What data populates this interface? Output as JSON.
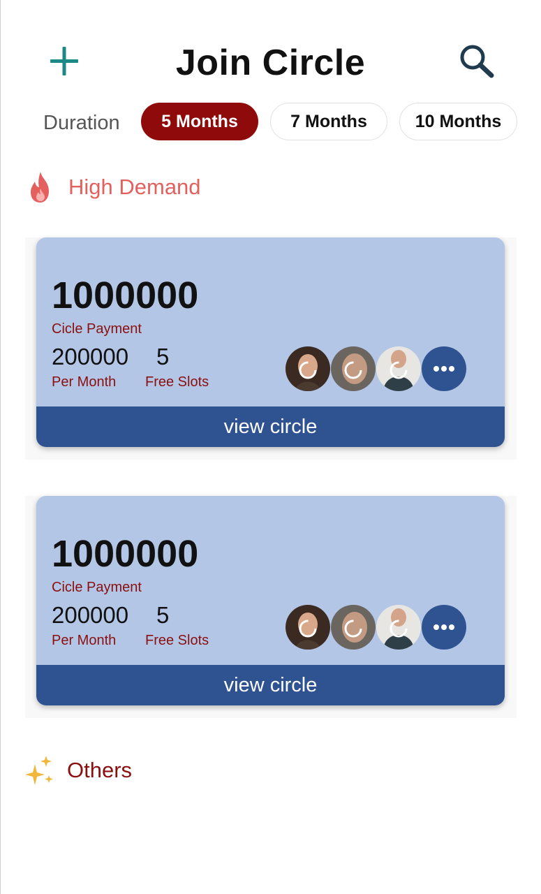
{
  "header": {
    "title": "Join Circle",
    "add_icon": "plus-icon",
    "search_icon": "search-icon"
  },
  "duration": {
    "label": "Duration",
    "options": [
      "5 Months",
      "7 Months",
      "10 Months"
    ],
    "selected": "5 Months"
  },
  "sections": {
    "high_demand": {
      "label": "High Demand",
      "icon": "fire-icon",
      "color": "#e4605e"
    },
    "others": {
      "label": "Others",
      "icon": "sparkles-icon",
      "color": "#8a1010"
    }
  },
  "circles": [
    {
      "amount": "1000000",
      "amount_label": "Cicle Payment",
      "per_month_value": "200000",
      "per_month_label": "Per Month",
      "free_slots_value": "5",
      "free_slots_label": "Free Slots",
      "view_label": "view circle"
    },
    {
      "amount": "1000000",
      "amount_label": "Cicle Payment",
      "per_month_value": "200000",
      "per_month_label": "Per Month",
      "free_slots_value": "5",
      "free_slots_label": "Free Slots",
      "view_label": "view circle"
    }
  ],
  "colors": {
    "accent": "#8f0b0b",
    "card_bg": "#b3c6e6",
    "button_bg": "#2f5391",
    "teal": "#1b8a86",
    "label_red": "#8a1010"
  }
}
